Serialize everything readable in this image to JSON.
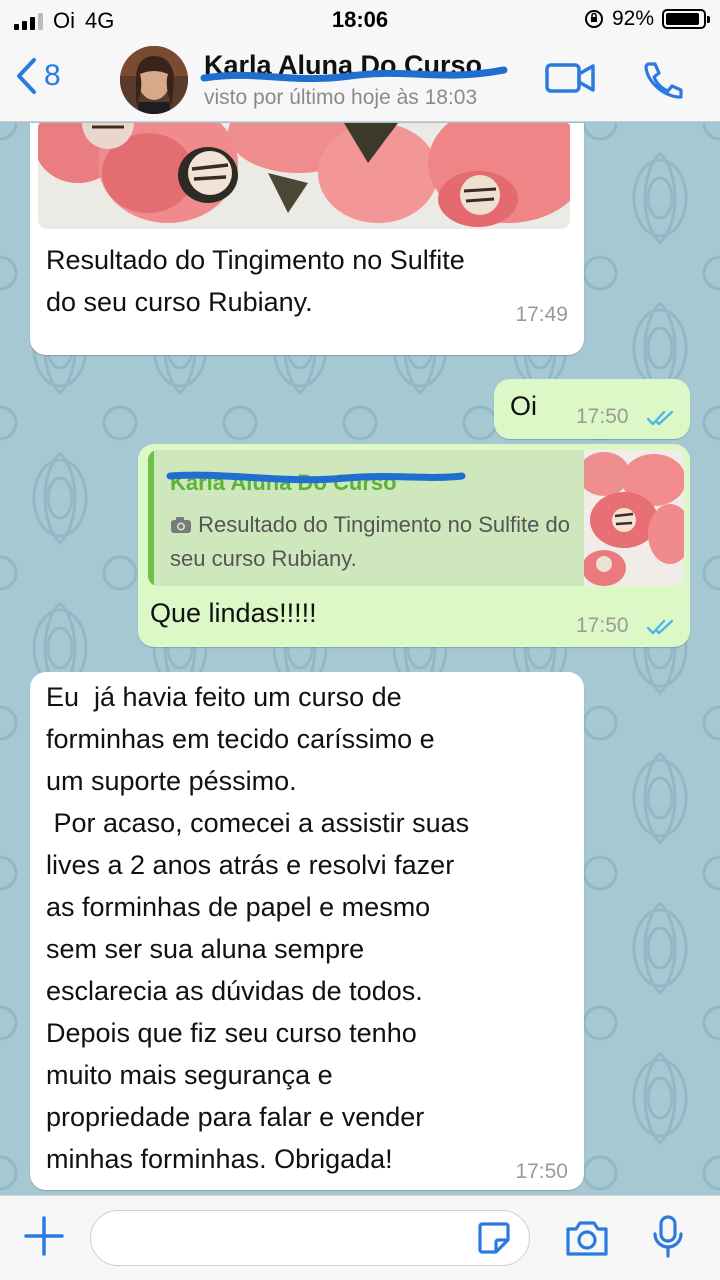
{
  "status_bar": {
    "carrier": "Oi",
    "network": "4G",
    "time": "18:06",
    "battery": "92%",
    "battery_level": 0.92
  },
  "header": {
    "back_count": "8",
    "contact_name": "Karla Aluna Do Curso",
    "last_seen": "visto por último hoje às 18:03",
    "icons": [
      "chevron-left-icon",
      "video-call-icon",
      "phone-icon"
    ]
  },
  "messages": [
    {
      "direction": "in",
      "text": "Resultado do Tingimento no Sulfite\ndo seu curso Rubiany.",
      "time": "17:49",
      "has_photo": true
    },
    {
      "direction": "out",
      "text": "Oi",
      "time": "17:50",
      "status": "read"
    },
    {
      "direction": "out",
      "quote_author": "Karla Aluna Do Curso",
      "quote_text": "Resultado do Tingimento no Sulfite do seu curso Rubiany.",
      "text": "Que lindas!!!!!",
      "time": "17:50",
      "status": "read"
    },
    {
      "direction": "in",
      "text": "Eu  já havia feito um curso de\nforminhas em tecido caríssimo e\num suporte péssimo.\n Por acaso, comecei a assistir suas\nlives a 2 anos atrás e resolvi fazer\nas forminhas de papel e mesmo\nsem ser sua aluna sempre\nesclarecia as dúvidas de todos.\nDepois que fiz seu curso tenho\nmuito mais segurança e\npropriedade para falar e vender\nminhas forminhas. Obrigada!",
      "time": "17:50"
    }
  ],
  "input_bar": {
    "placeholder": "",
    "icons": [
      "plus-icon",
      "sticker-icon",
      "camera-icon",
      "microphone-icon"
    ]
  },
  "colors": {
    "accent": "#2a7ae2",
    "outgoing_bubble": "#dcf8c6",
    "incoming_bubble": "#ffffff",
    "chat_background": "#a5c8d3",
    "read_ticks": "#4fb6ec",
    "quote_author": "#5cb339"
  }
}
